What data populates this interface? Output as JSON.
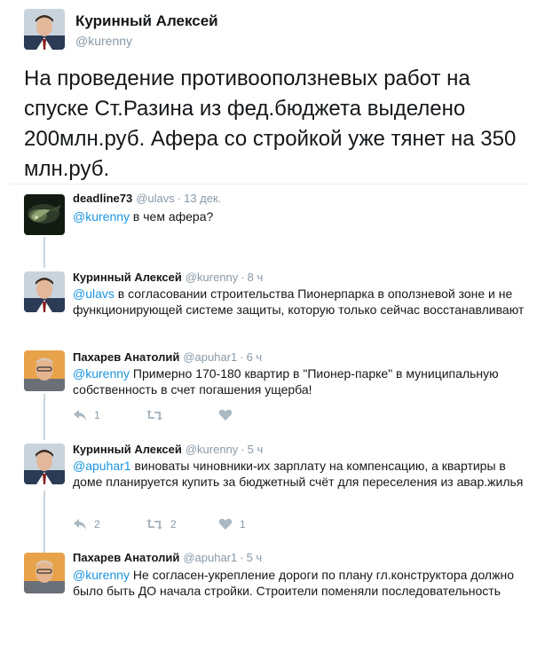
{
  "main_tweet": {
    "author_name": "Куринный Алексей",
    "author_handle": "@kurenny",
    "text": "На проведение противооползневых работ на спуске Ст.Разина из фед.бюджета выделено 200млн.руб. Афера со стройкой уже тянет на 350 млн.руб."
  },
  "replies": [
    {
      "author_name": "deadline73",
      "author_handle": "@ulavs",
      "time": "13 дек.",
      "mention": "@kurenny",
      "text": " в чем афера?"
    },
    {
      "author_name": "Куринный Алексей",
      "author_handle": "@kurenny",
      "time": "8 ч",
      "mention": "@ulavs",
      "text": " в согласовании строительства Пионерпарка в оползневой зоне и не функционирующей системе защиты, которую только сейчас восстанавливают"
    },
    {
      "author_name": "Пахарев Анатолий",
      "author_handle": "@apuhar1",
      "time": "6 ч",
      "mention": "@kurenny",
      "text": " Примерно 170-180 квартир в \"Пионер-парке\" в муниципальную собственность в счет погашения ущерба!",
      "actions": {
        "reply_count": "1",
        "retweet_count": "",
        "like_count": ""
      }
    },
    {
      "author_name": "Куринный Алексей",
      "author_handle": "@kurenny",
      "time": "5 ч",
      "mention": "@apuhar1",
      "text": " виноваты чиновники-их зарплату на компенсацию, а квартиры в доме планируется купить за бюджетный счёт для переселения из авар.жилья",
      "actions": {
        "reply_count": "2",
        "retweet_count": "2",
        "like_count": "1"
      }
    },
    {
      "author_name": "Пахарев Анатолий",
      "author_handle": "@apuhar1",
      "time": "5 ч",
      "mention": "@kurenny",
      "text": " Не согласен-укрепление дороги по плану гл.конструктора должно было быть ДО начала стройки. Строители поменяли последовательность"
    }
  ],
  "colors": {
    "link": "#1b95e0",
    "muted": "#8899a6",
    "thread_line": "#ccd6dd",
    "text": "#14171a"
  },
  "icons": {
    "reply": "reply-icon",
    "retweet": "retweet-icon",
    "like": "heart-icon"
  }
}
